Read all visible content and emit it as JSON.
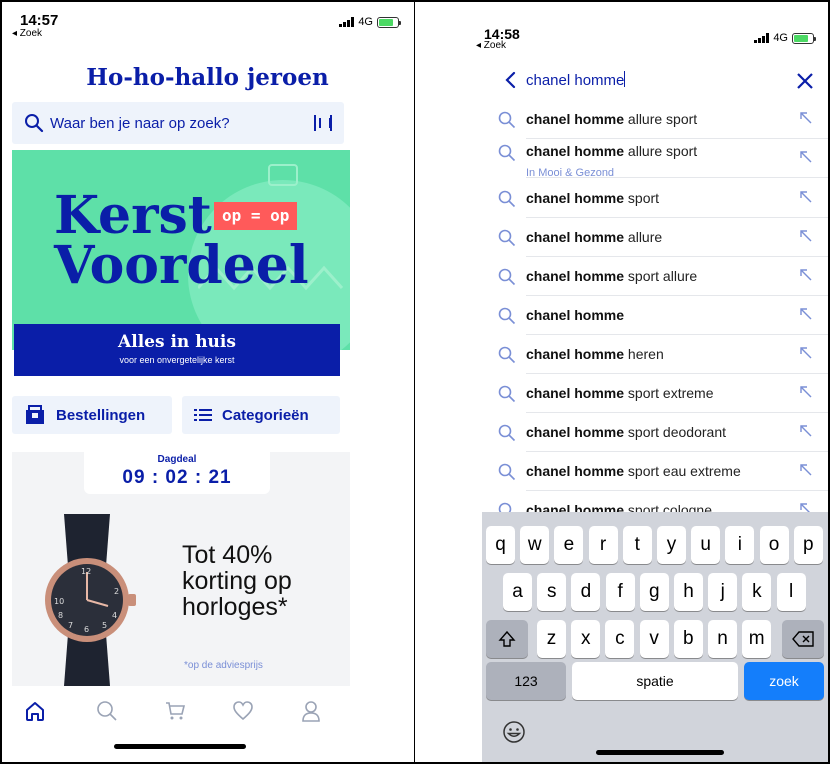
{
  "left": {
    "status": {
      "time": "14:57",
      "back": "◂ Zoek",
      "network": "4G"
    },
    "greeting": "Ho-ho-hallo jeroen",
    "search": {
      "placeholder": "Waar ben je naar op zoek?"
    },
    "banner": {
      "line1": "Kerst",
      "line2": "Voordeel",
      "badge": "op = op",
      "strip_title": "Alles in huis",
      "strip_sub": "voor een onvergetelijke kerst"
    },
    "buttons": {
      "orders": "Bestellingen",
      "categories": "Categorieën"
    },
    "deal": {
      "label": "Dagdeal",
      "timer": "09 : 02 : 21",
      "text_1": "Tot 40%",
      "text_2": "korting op",
      "text_3": "horloges*",
      "note": "*op de adviesprijs"
    },
    "tabs": [
      "home-icon",
      "search-icon",
      "cart-icon",
      "heart-icon",
      "profile-icon"
    ]
  },
  "right": {
    "status": {
      "time": "14:58",
      "back": "◂ Zoek",
      "network": "4G"
    },
    "query": "chanel homme",
    "suggestions": [
      {
        "bold": "chanel homme",
        "rest": " allure sport",
        "sub": ""
      },
      {
        "bold": "chanel homme",
        "rest": " allure sport",
        "sub": "In Mooi & Gezond"
      },
      {
        "bold": "chanel homme",
        "rest": " sport",
        "sub": ""
      },
      {
        "bold": "chanel homme",
        "rest": " allure",
        "sub": ""
      },
      {
        "bold": "chanel homme",
        "rest": " sport allure",
        "sub": ""
      },
      {
        "bold": "chanel homme",
        "rest": "",
        "sub": ""
      },
      {
        "bold": "chanel homme",
        "rest": " heren",
        "sub": ""
      },
      {
        "bold": "chanel homme",
        "rest": " sport extreme",
        "sub": ""
      },
      {
        "bold": "chanel homme",
        "rest": " sport deodorant",
        "sub": ""
      },
      {
        "bold": "chanel homme",
        "rest": " sport eau extreme",
        "sub": ""
      },
      {
        "bold": "chanel homme",
        "rest": " sport cologne",
        "sub": ""
      }
    ],
    "keyboard": {
      "row1": [
        "q",
        "w",
        "e",
        "r",
        "t",
        "y",
        "u",
        "i",
        "o",
        "p"
      ],
      "row2": [
        "a",
        "s",
        "d",
        "f",
        "g",
        "h",
        "j",
        "k",
        "l"
      ],
      "row3": [
        "z",
        "x",
        "c",
        "v",
        "b",
        "n",
        "m"
      ],
      "numbers": "123",
      "space": "spatie",
      "go": "zoek"
    }
  },
  "colors": {
    "brand": "#0a1ea8",
    "mint": "#5ee0a8",
    "red": "#ff5a5a",
    "ios_blue": "#147efb"
  }
}
